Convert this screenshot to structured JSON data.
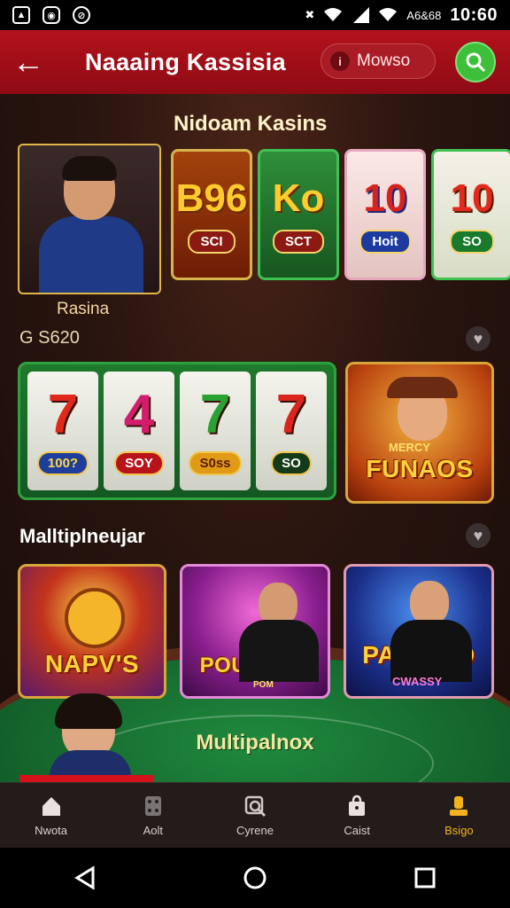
{
  "status_bar": {
    "time": "10:60",
    "carrier": "A6&68",
    "left_icons": [
      "image-icon",
      "instagram-icon",
      "sync-icon"
    ]
  },
  "app_bar": {
    "title": "Naaaing Kassisia",
    "pill_label": "Mowso",
    "colors": {
      "bar": "#b3121c",
      "action": "#3dbf3a"
    }
  },
  "featured": {
    "section_title": "Nidoam Kasins",
    "host_label": "Rasina",
    "balance": "S620",
    "cards": [
      {
        "big": "B96",
        "chip": "SCI"
      },
      {
        "big": "Ko",
        "chip": "SCT"
      },
      {
        "big": "10",
        "chip": "Hoit"
      },
      {
        "big": "10",
        "chip": "SO"
      }
    ]
  },
  "slots": {
    "reels": [
      {
        "num": "7",
        "tag": "100?"
      },
      {
        "num": "4",
        "tag": "SOY"
      },
      {
        "num": "7",
        "tag": "S0ss"
      },
      {
        "num": "7",
        "tag": "SO"
      }
    ],
    "promo_title": "FUNAOS",
    "promo_sub": "MERCY"
  },
  "multiplayer": {
    "section_title": "Malltiplneujar",
    "tiles": [
      {
        "title": "NAPV'S"
      },
      {
        "title": "POURENO",
        "sub": "POM"
      },
      {
        "title": "PASSICO",
        "sub": "CWASSY"
      }
    ],
    "footer_label": "Multipalnox"
  },
  "bottom_nav": [
    {
      "label": "Nwota",
      "icon": "home-icon",
      "active": false
    },
    {
      "label": "Aolt",
      "icon": "dice-icon",
      "active": false
    },
    {
      "label": "Cyrene",
      "icon": "search-icon",
      "active": false
    },
    {
      "label": "Caist",
      "icon": "bag-icon",
      "active": false
    },
    {
      "label": "Bsigo",
      "icon": "profile-icon",
      "active": true
    }
  ]
}
